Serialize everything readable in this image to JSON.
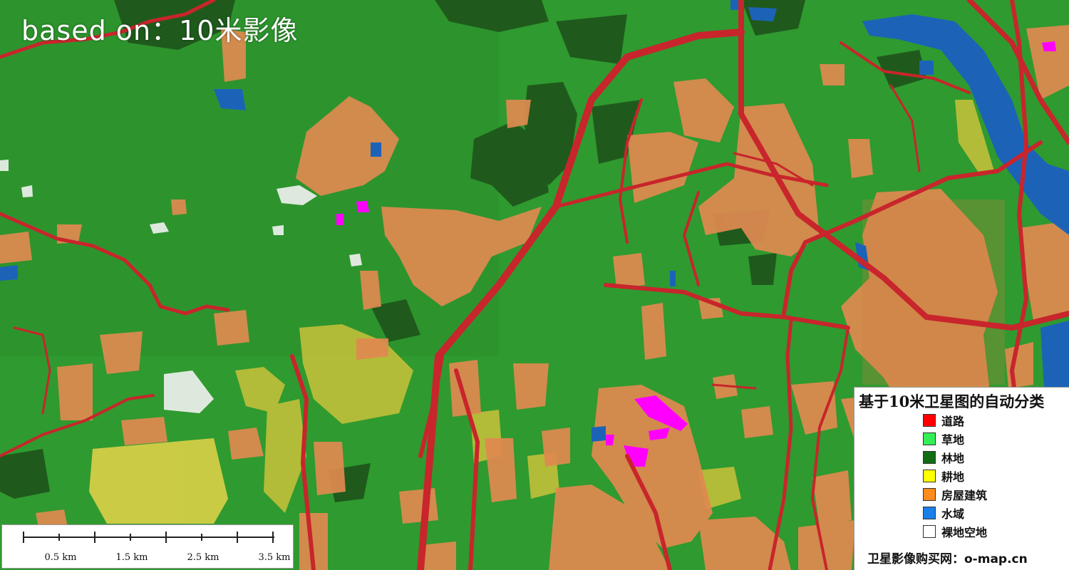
{
  "map": {
    "title_overlay": "based on：10米影像",
    "colors": {
      "base_green": "#2f9a2f",
      "forest": "#1f5a1c",
      "building": "#e08a50",
      "cropland": "#c9c23a",
      "water": "#1c63b8",
      "road": "#c8252c",
      "bare": "#f2f2f2",
      "magenta": "#ff00ff"
    }
  },
  "legend": {
    "title": "基于10米卫星图的自动分类",
    "items": [
      {
        "label": "道路",
        "color": "#ff0000"
      },
      {
        "label": "草地",
        "color": "#33ee55"
      },
      {
        "label": "林地",
        "color": "#126d12"
      },
      {
        "label": "耕地",
        "color": "#ffff00"
      },
      {
        "label": "房屋建筑",
        "color": "#ff8a1e"
      },
      {
        "label": "水域",
        "color": "#1a7fe8"
      },
      {
        "label": "裸地空地",
        "color": "#ffffff"
      }
    ],
    "credit": "卫星影像购买网：o-map.cn"
  },
  "scale_bar": {
    "labels": [
      "0.5 km",
      "1.5 km",
      "2.5 km",
      "3.5 km"
    ]
  }
}
